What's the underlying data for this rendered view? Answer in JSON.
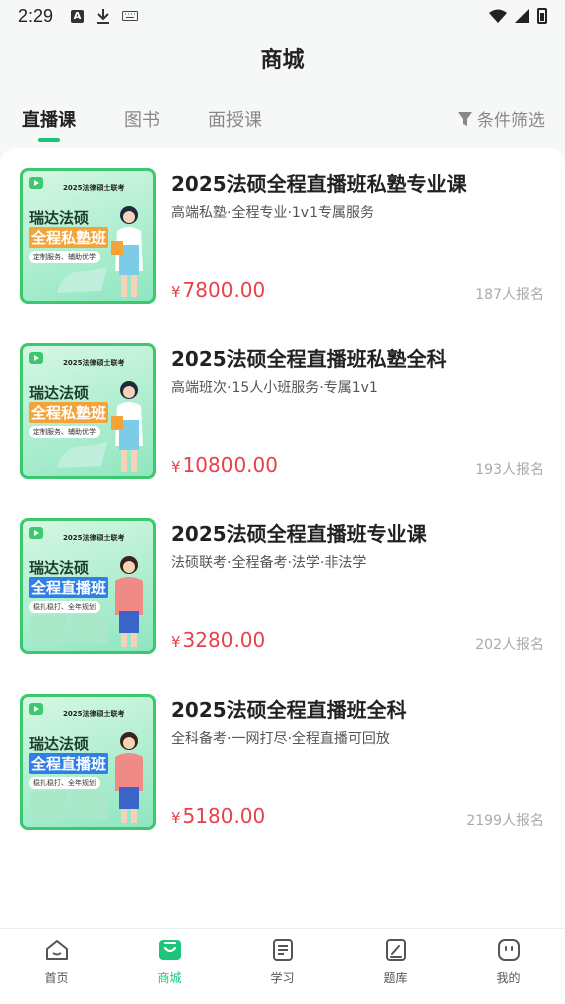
{
  "status_bar": {
    "time": "2:29"
  },
  "header": {
    "title": "商城"
  },
  "tabs": [
    {
      "label": "直播课",
      "active": true
    },
    {
      "label": "图书",
      "active": false
    },
    {
      "label": "面授课",
      "active": false
    }
  ],
  "filter": {
    "label": "条件筛选"
  },
  "products": [
    {
      "title": "2025法硕全程直播班私塾专业课",
      "subtitle": "高端私塾·全程专业·1v1专属服务",
      "currency": "¥",
      "price": "7800.00",
      "enrolled": "187人报名",
      "thumb": {
        "exam": "2025法律硕士联考",
        "line1": "瑞达法硕",
        "line2": "全程私塾班",
        "line3": "定制服务、辅助优学",
        "theme": "orange"
      }
    },
    {
      "title": "2025法硕全程直播班私塾全科",
      "subtitle": "高端班次·15人小班服务·专属1v1",
      "currency": "¥",
      "price": "10800.00",
      "enrolled": "193人报名",
      "thumb": {
        "exam": "2025法律硕士联考",
        "line1": "瑞达法硕",
        "line2": "全程私塾班",
        "line3": "定制服务、辅助优学",
        "theme": "orange"
      }
    },
    {
      "title": "2025法硕全程直播班专业课",
      "subtitle": "法硕联考·全程备考·法学·非法学",
      "currency": "¥",
      "price": "3280.00",
      "enrolled": "202人报名",
      "thumb": {
        "exam": "2025法律硕士联考",
        "line1": "瑞达法硕",
        "line2": "全程直播班",
        "line3": "稳扎稳打、全年规划",
        "theme": "blue"
      }
    },
    {
      "title": "2025法硕全程直播班全科",
      "subtitle": "全科备考·一网打尽·全程直播可回放",
      "currency": "¥",
      "price": "5180.00",
      "enrolled": "2199人报名",
      "thumb": {
        "exam": "2025法律硕士联考",
        "line1": "瑞达法硕",
        "line2": "全程直播班",
        "line3": "稳扎稳打、全年规划",
        "theme": "blue"
      }
    }
  ],
  "bottom_nav": [
    {
      "label": "首页",
      "icon": "home-icon",
      "active": false
    },
    {
      "label": "商城",
      "icon": "shop-icon",
      "active": true
    },
    {
      "label": "学习",
      "icon": "study-icon",
      "active": false
    },
    {
      "label": "题库",
      "icon": "question-bank-icon",
      "active": false
    },
    {
      "label": "我的",
      "icon": "profile-icon",
      "active": false
    }
  ],
  "colors": {
    "accent": "#1ec47c",
    "price": "#e8414a",
    "thumb_border": "#3cc86d"
  }
}
